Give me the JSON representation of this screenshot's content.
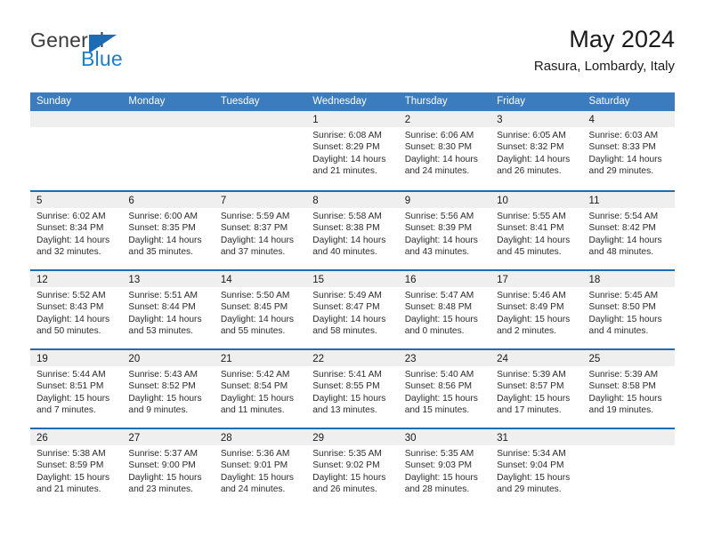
{
  "logo": {
    "word1": "General",
    "word2": "Blue",
    "triangle_color": "#1b6cb5",
    "blue_text_color": "#1b7fd1"
  },
  "header": {
    "title": "May 2024",
    "subtitle": "Rasura, Lombardy, Italy"
  },
  "theme": {
    "header_blue": "#3b7cbf",
    "row_divider_blue": "#1f6cb0",
    "day_band_gray": "#efefef"
  },
  "weekdays": [
    "Sunday",
    "Monday",
    "Tuesday",
    "Wednesday",
    "Thursday",
    "Friday",
    "Saturday"
  ],
  "weeks": [
    [
      {
        "day": "",
        "empty": true,
        "lines": []
      },
      {
        "day": "",
        "empty": true,
        "lines": []
      },
      {
        "day": "",
        "empty": true,
        "lines": []
      },
      {
        "day": "1",
        "empty": false,
        "lines": [
          "Sunrise: 6:08 AM",
          "Sunset: 8:29 PM",
          "Daylight: 14 hours",
          "and 21 minutes."
        ]
      },
      {
        "day": "2",
        "empty": false,
        "lines": [
          "Sunrise: 6:06 AM",
          "Sunset: 8:30 PM",
          "Daylight: 14 hours",
          "and 24 minutes."
        ]
      },
      {
        "day": "3",
        "empty": false,
        "lines": [
          "Sunrise: 6:05 AM",
          "Sunset: 8:32 PM",
          "Daylight: 14 hours",
          "and 26 minutes."
        ]
      },
      {
        "day": "4",
        "empty": false,
        "lines": [
          "Sunrise: 6:03 AM",
          "Sunset: 8:33 PM",
          "Daylight: 14 hours",
          "and 29 minutes."
        ]
      }
    ],
    [
      {
        "day": "5",
        "empty": false,
        "lines": [
          "Sunrise: 6:02 AM",
          "Sunset: 8:34 PM",
          "Daylight: 14 hours",
          "and 32 minutes."
        ]
      },
      {
        "day": "6",
        "empty": false,
        "lines": [
          "Sunrise: 6:00 AM",
          "Sunset: 8:35 PM",
          "Daylight: 14 hours",
          "and 35 minutes."
        ]
      },
      {
        "day": "7",
        "empty": false,
        "lines": [
          "Sunrise: 5:59 AM",
          "Sunset: 8:37 PM",
          "Daylight: 14 hours",
          "and 37 minutes."
        ]
      },
      {
        "day": "8",
        "empty": false,
        "lines": [
          "Sunrise: 5:58 AM",
          "Sunset: 8:38 PM",
          "Daylight: 14 hours",
          "and 40 minutes."
        ]
      },
      {
        "day": "9",
        "empty": false,
        "lines": [
          "Sunrise: 5:56 AM",
          "Sunset: 8:39 PM",
          "Daylight: 14 hours",
          "and 43 minutes."
        ]
      },
      {
        "day": "10",
        "empty": false,
        "lines": [
          "Sunrise: 5:55 AM",
          "Sunset: 8:41 PM",
          "Daylight: 14 hours",
          "and 45 minutes."
        ]
      },
      {
        "day": "11",
        "empty": false,
        "lines": [
          "Sunrise: 5:54 AM",
          "Sunset: 8:42 PM",
          "Daylight: 14 hours",
          "and 48 minutes."
        ]
      }
    ],
    [
      {
        "day": "12",
        "empty": false,
        "lines": [
          "Sunrise: 5:52 AM",
          "Sunset: 8:43 PM",
          "Daylight: 14 hours",
          "and 50 minutes."
        ]
      },
      {
        "day": "13",
        "empty": false,
        "lines": [
          "Sunrise: 5:51 AM",
          "Sunset: 8:44 PM",
          "Daylight: 14 hours",
          "and 53 minutes."
        ]
      },
      {
        "day": "14",
        "empty": false,
        "lines": [
          "Sunrise: 5:50 AM",
          "Sunset: 8:45 PM",
          "Daylight: 14 hours",
          "and 55 minutes."
        ]
      },
      {
        "day": "15",
        "empty": false,
        "lines": [
          "Sunrise: 5:49 AM",
          "Sunset: 8:47 PM",
          "Daylight: 14 hours",
          "and 58 minutes."
        ]
      },
      {
        "day": "16",
        "empty": false,
        "lines": [
          "Sunrise: 5:47 AM",
          "Sunset: 8:48 PM",
          "Daylight: 15 hours",
          "and 0 minutes."
        ]
      },
      {
        "day": "17",
        "empty": false,
        "lines": [
          "Sunrise: 5:46 AM",
          "Sunset: 8:49 PM",
          "Daylight: 15 hours",
          "and 2 minutes."
        ]
      },
      {
        "day": "18",
        "empty": false,
        "lines": [
          "Sunrise: 5:45 AM",
          "Sunset: 8:50 PM",
          "Daylight: 15 hours",
          "and 4 minutes."
        ]
      }
    ],
    [
      {
        "day": "19",
        "empty": false,
        "lines": [
          "Sunrise: 5:44 AM",
          "Sunset: 8:51 PM",
          "Daylight: 15 hours",
          "and 7 minutes."
        ]
      },
      {
        "day": "20",
        "empty": false,
        "lines": [
          "Sunrise: 5:43 AM",
          "Sunset: 8:52 PM",
          "Daylight: 15 hours",
          "and 9 minutes."
        ]
      },
      {
        "day": "21",
        "empty": false,
        "lines": [
          "Sunrise: 5:42 AM",
          "Sunset: 8:54 PM",
          "Daylight: 15 hours",
          "and 11 minutes."
        ]
      },
      {
        "day": "22",
        "empty": false,
        "lines": [
          "Sunrise: 5:41 AM",
          "Sunset: 8:55 PM",
          "Daylight: 15 hours",
          "and 13 minutes."
        ]
      },
      {
        "day": "23",
        "empty": false,
        "lines": [
          "Sunrise: 5:40 AM",
          "Sunset: 8:56 PM",
          "Daylight: 15 hours",
          "and 15 minutes."
        ]
      },
      {
        "day": "24",
        "empty": false,
        "lines": [
          "Sunrise: 5:39 AM",
          "Sunset: 8:57 PM",
          "Daylight: 15 hours",
          "and 17 minutes."
        ]
      },
      {
        "day": "25",
        "empty": false,
        "lines": [
          "Sunrise: 5:39 AM",
          "Sunset: 8:58 PM",
          "Daylight: 15 hours",
          "and 19 minutes."
        ]
      }
    ],
    [
      {
        "day": "26",
        "empty": false,
        "lines": [
          "Sunrise: 5:38 AM",
          "Sunset: 8:59 PM",
          "Daylight: 15 hours",
          "and 21 minutes."
        ]
      },
      {
        "day": "27",
        "empty": false,
        "lines": [
          "Sunrise: 5:37 AM",
          "Sunset: 9:00 PM",
          "Daylight: 15 hours",
          "and 23 minutes."
        ]
      },
      {
        "day": "28",
        "empty": false,
        "lines": [
          "Sunrise: 5:36 AM",
          "Sunset: 9:01 PM",
          "Daylight: 15 hours",
          "and 24 minutes."
        ]
      },
      {
        "day": "29",
        "empty": false,
        "lines": [
          "Sunrise: 5:35 AM",
          "Sunset: 9:02 PM",
          "Daylight: 15 hours",
          "and 26 minutes."
        ]
      },
      {
        "day": "30",
        "empty": false,
        "lines": [
          "Sunrise: 5:35 AM",
          "Sunset: 9:03 PM",
          "Daylight: 15 hours",
          "and 28 minutes."
        ]
      },
      {
        "day": "31",
        "empty": false,
        "lines": [
          "Sunrise: 5:34 AM",
          "Sunset: 9:04 PM",
          "Daylight: 15 hours",
          "and 29 minutes."
        ]
      },
      {
        "day": "",
        "empty": true,
        "lines": []
      }
    ]
  ]
}
